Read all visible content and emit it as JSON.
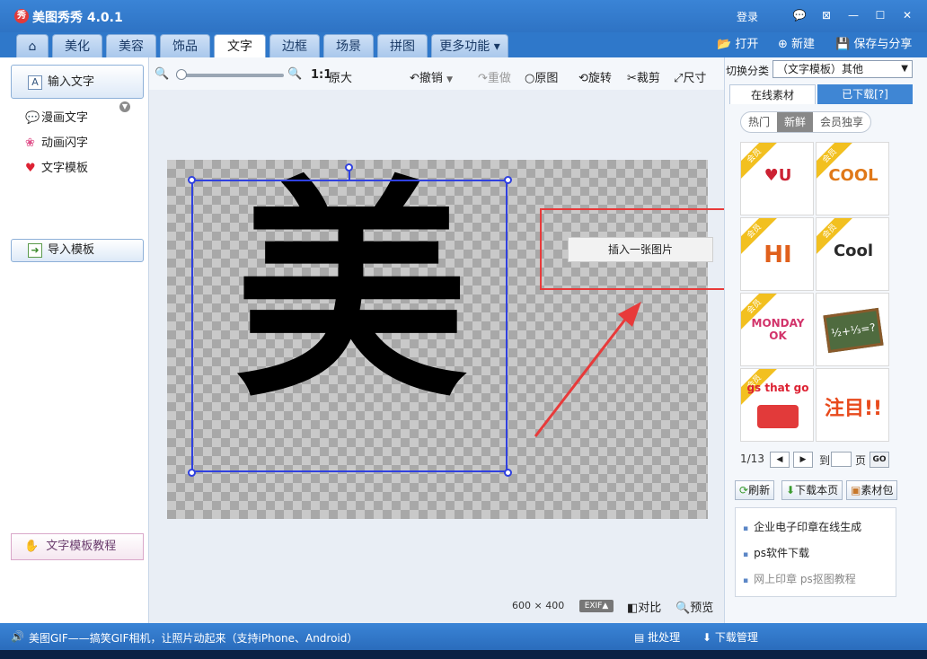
{
  "app": {
    "title": "美图秀秀 4.0.1",
    "logo": "秀",
    "login": "登录"
  },
  "window_controls": [
    "💬",
    "⊠",
    "—",
    "☐",
    "✕"
  ],
  "tabs": [
    {
      "label": "⌂",
      "icon": "home-icon"
    },
    {
      "label": "美化"
    },
    {
      "label": "美容"
    },
    {
      "label": "饰品"
    },
    {
      "label": "文字",
      "active": true
    },
    {
      "label": "边框"
    },
    {
      "label": "场景"
    },
    {
      "label": "拼图"
    },
    {
      "label": "更多功能 ▾"
    }
  ],
  "top_actions": {
    "open": "打开",
    "new": "新建",
    "save": "保存与分享"
  },
  "left": {
    "input_text": "输入文字",
    "items": [
      "漫画文字",
      "动画闪字",
      "文字模板"
    ],
    "import": "导入模板",
    "tutorial": "文字模板教程"
  },
  "toolbar": {
    "ratio": "1:1",
    "original_size": "原大",
    "undo": "撤销",
    "redo": "重做",
    "original": "原图",
    "rotate": "旋转",
    "crop": "裁剪",
    "size": "尺寸"
  },
  "canvas": {
    "char": "美",
    "context_menu_item": "插入一张图片",
    "width": "600",
    "height": "400",
    "exif": "EXIF▲",
    "compare": "对比",
    "preview": "预览"
  },
  "right": {
    "switch_label": "切换分类",
    "category": "（文字模板）其他",
    "tab_online": "在线素材",
    "tab_downloaded": "已下载[?]",
    "subtabs": [
      "热门",
      "新鲜",
      "会员独享"
    ],
    "member_badge": "会员",
    "thumbs": [
      "♥U",
      "COOL",
      "HI",
      "Cool",
      "MONDAY OK",
      "½+⅓=?",
      "gs that go",
      "注目!!"
    ],
    "page": "1/13",
    "page_to": "到",
    "page_unit": "页",
    "go": "GO",
    "refresh": "刷新",
    "download_page": "下载本页",
    "material_pack": "素材包",
    "links": [
      "企业电子印章在线生成",
      "ps软件下载",
      "网上印章   ps抠图教程"
    ]
  },
  "status": {
    "message": "美图GIF——搞笑GIF相机，让照片动起来（支持iPhone、Android）",
    "batch": "批处理",
    "download_manage": "下载管理"
  }
}
